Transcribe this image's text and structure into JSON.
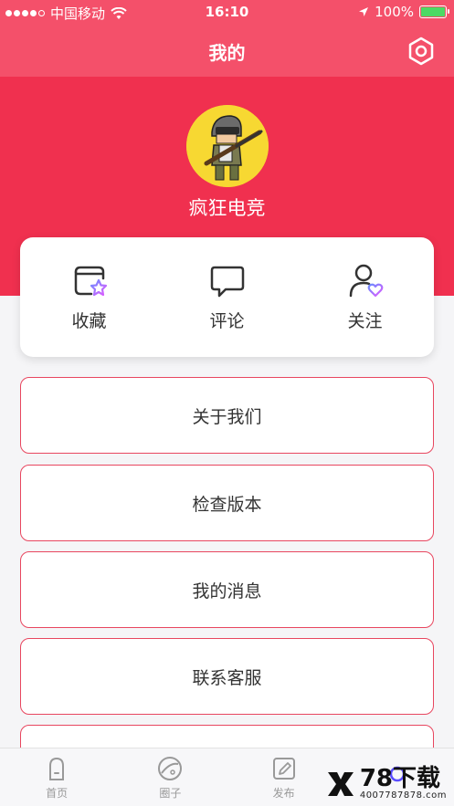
{
  "status_bar": {
    "carrier": "中国移动",
    "time": "16:10",
    "battery": "100%"
  },
  "nav": {
    "title": "我的"
  },
  "profile": {
    "username": "疯狂电竞"
  },
  "actions": [
    {
      "label": "收藏"
    },
    {
      "label": "评论"
    },
    {
      "label": "关注"
    }
  ],
  "menu": [
    {
      "label": "关于我们"
    },
    {
      "label": "检查版本"
    },
    {
      "label": "我的消息"
    },
    {
      "label": "联系客服"
    }
  ],
  "tabs": [
    {
      "label": "首页"
    },
    {
      "label": "圈子"
    },
    {
      "label": "发布"
    },
    {
      "label": ""
    }
  ],
  "watermark": {
    "main": "78下载",
    "sub": "4007787878.com"
  },
  "colors": {
    "header": "#f0304f",
    "nav": "#f4506a",
    "menu_border": "#e8465f"
  }
}
